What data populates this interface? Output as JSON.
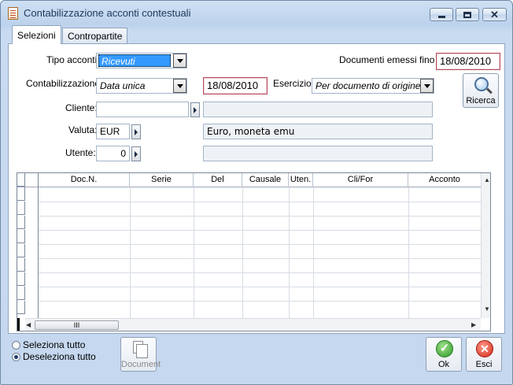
{
  "window": {
    "title": "Contabilizzazione acconti contestuali"
  },
  "tabs": [
    {
      "label": "Selezioni",
      "active": true
    },
    {
      "label": "Contropartite",
      "active": false
    }
  ],
  "form": {
    "tipo_acconti": {
      "label": "Tipo acconti:",
      "value": "Ricevuti"
    },
    "documenti_emessi": {
      "label": "Documenti emessi fino al:",
      "value": "18/08/2010"
    },
    "contabilizzazione": {
      "label": "Contabilizzazione:",
      "value": "Data unica",
      "date": "18/08/2010"
    },
    "esercizio": {
      "label": "Esercizio:",
      "value": "Per documento di origine"
    },
    "cliente": {
      "label": "Cliente:",
      "code": "",
      "description": ""
    },
    "valuta": {
      "label": "Valuta:",
      "code": "EUR",
      "description": "Euro, moneta emu"
    },
    "utente": {
      "label": "Utente:",
      "code": "0",
      "description": ""
    }
  },
  "ricerca_button": {
    "label": "Ricerca",
    "icon": "magnifier-icon"
  },
  "grid": {
    "columns": [
      "Doc.N.",
      "Serie",
      "Del",
      "Causale",
      "Uten.",
      "Cli/For",
      "Acconto"
    ],
    "rows": [],
    "scroll_thumb": "III"
  },
  "selection": {
    "select_all": "Seleziona tutto",
    "deselect_all": "Deseleziona tutto",
    "selected": "deselect_all"
  },
  "buttons": {
    "document": "Document",
    "ok": "Ok",
    "esci": "Esci"
  }
}
